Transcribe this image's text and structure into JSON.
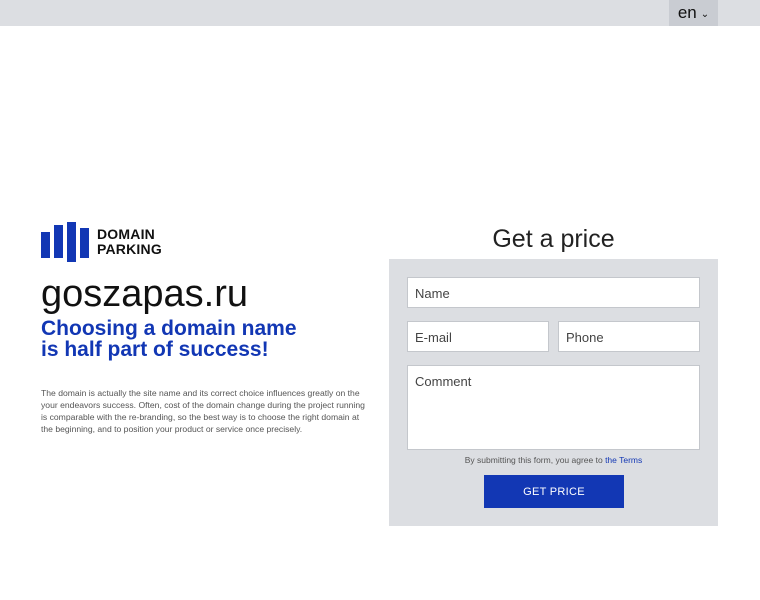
{
  "header": {
    "lang_label": "en"
  },
  "logo": {
    "line1": "DOMAIN",
    "line2": "PARKING"
  },
  "main": {
    "domain": "goszapas.ru",
    "tagline_line1": "Choosing a domain name",
    "tagline_line2": "is half part of success!",
    "description": "The domain is actually the site name and its correct choice influences greatly on the your endeavors success. Often, cost of the domain change during the project running is comparable with the re-branding, so the best way is to choose the right domain at the beginning, and to position your product or service once precisely."
  },
  "form": {
    "title": "Get a price",
    "name_placeholder": "Name",
    "email_placeholder": "E-mail",
    "phone_placeholder": "Phone",
    "comment_placeholder": "Comment",
    "terms_prefix": "By submitting this form, you agree to ",
    "terms_link": "the Terms",
    "submit_label": "GET PRICE"
  },
  "colors": {
    "accent": "#1237b4",
    "panel_bg": "#dcdee2"
  }
}
